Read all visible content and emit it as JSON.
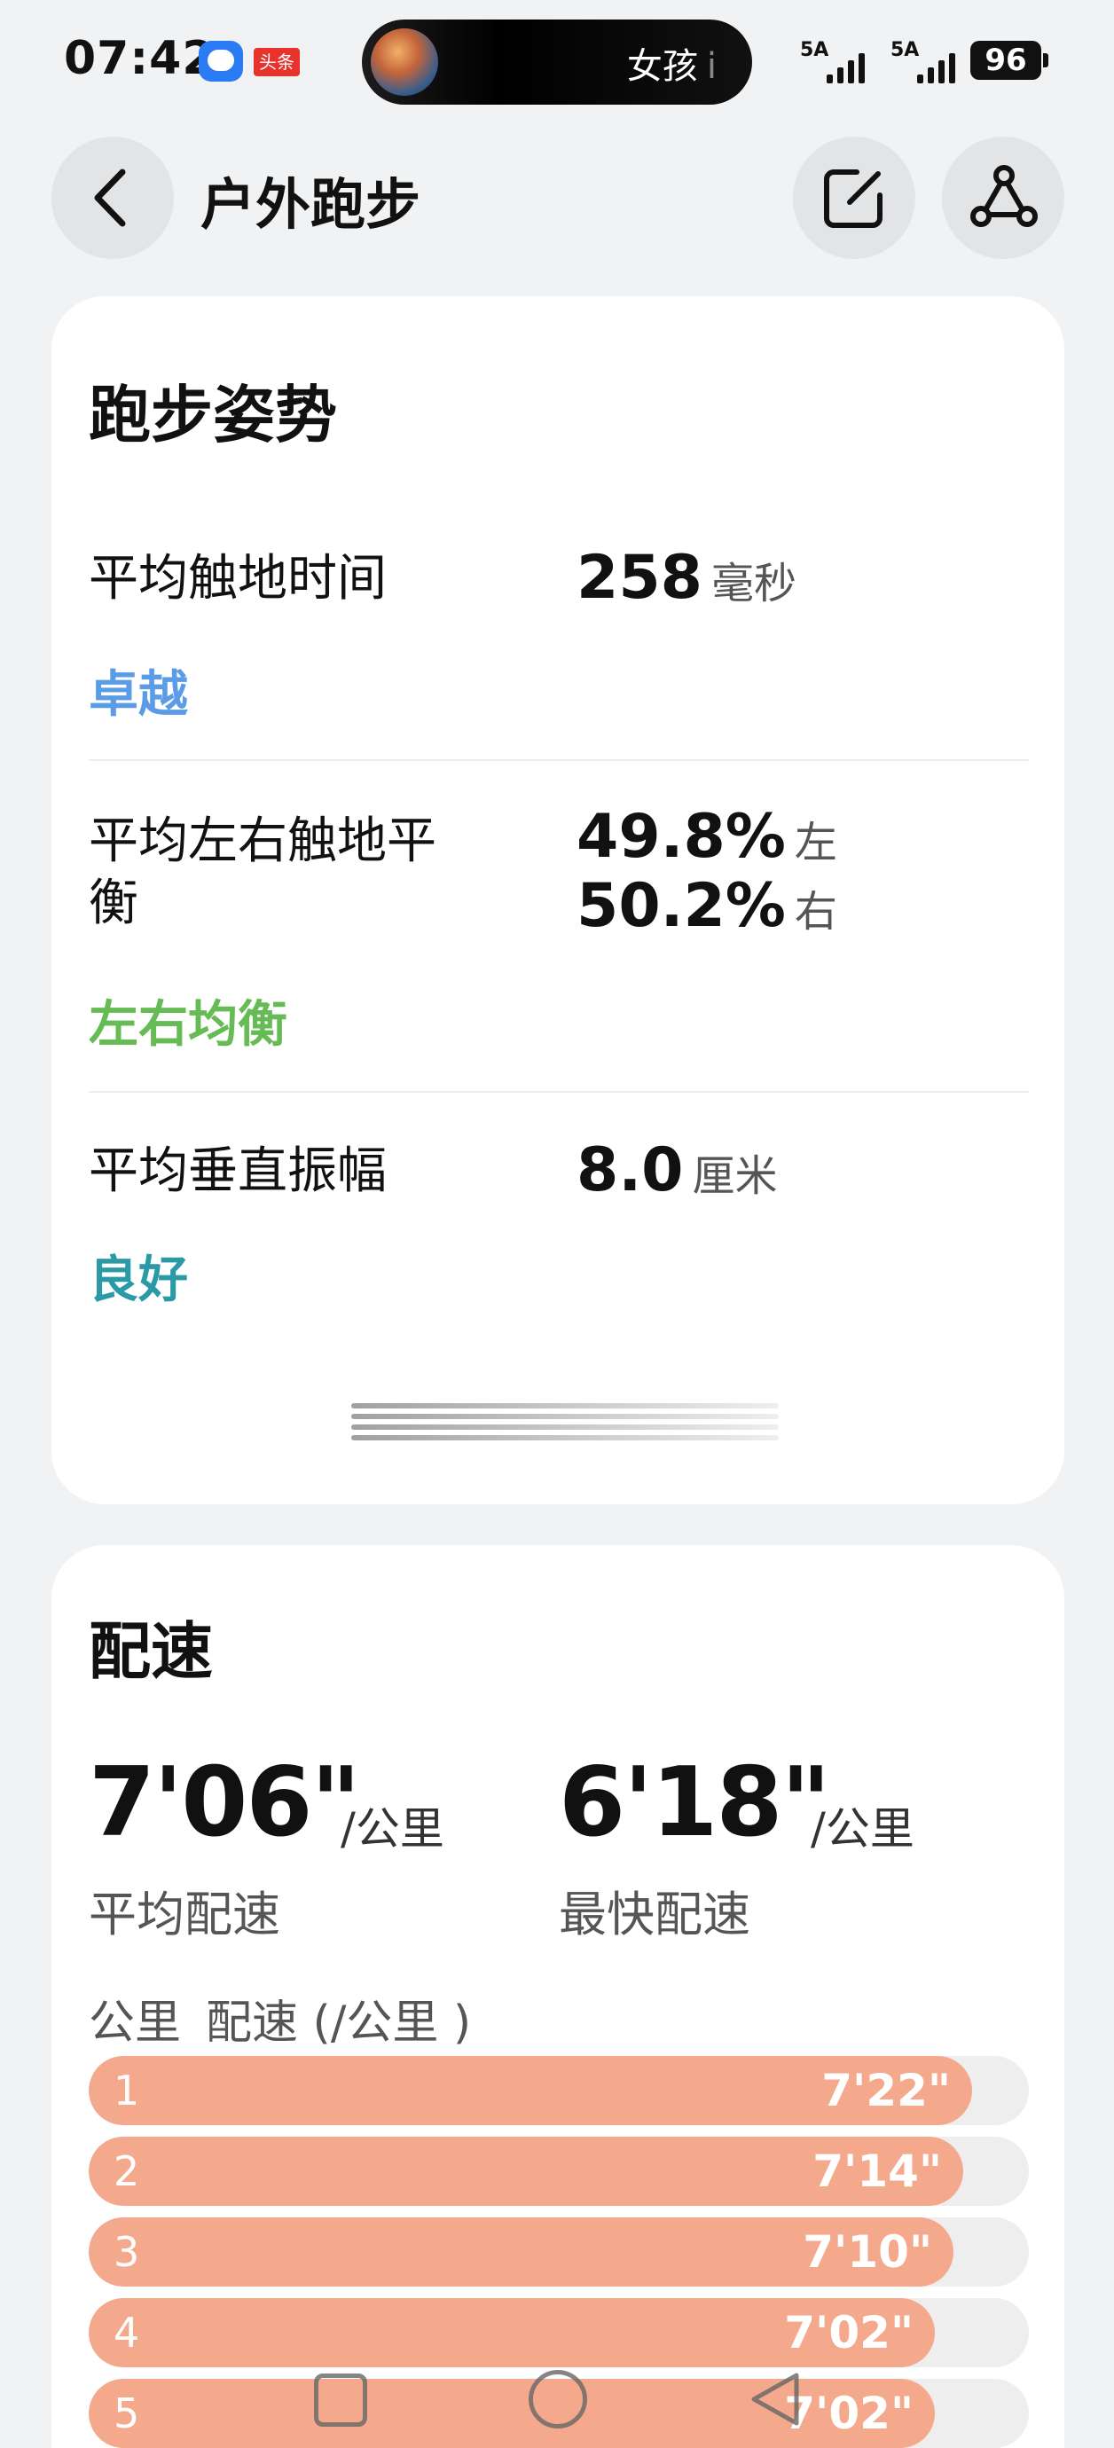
{
  "status_bar": {
    "time": "07:42",
    "toutiao_badge": "头条",
    "media_title": "女孩",
    "media_info_glyph": "i",
    "signal_1": "5A",
    "signal_2": "5A",
    "battery": "96"
  },
  "header": {
    "title": "户外跑步"
  },
  "running_posture": {
    "title": "跑步姿势",
    "contact_time": {
      "label": "平均触地时间",
      "value": "258",
      "unit": "毫秒",
      "rating": "卓越",
      "rating_color": "#5a9de6"
    },
    "balance": {
      "label_line1": "平均左右触地平",
      "label_line2": "衡",
      "left_value": "49.8%",
      "left_unit": "左",
      "right_value": "50.2%",
      "right_unit": "右",
      "rating": "左右均衡",
      "rating_color": "#66bb55"
    },
    "vertical_oscillation": {
      "label": "平均垂直振幅",
      "value": "8.0",
      "unit": "厘米",
      "rating": "良好",
      "rating_color": "#2a9aa6"
    }
  },
  "pace": {
    "title": "配速",
    "average": {
      "value": "7'06\"",
      "unit": "/公里",
      "caption": "平均配速"
    },
    "fastest": {
      "value": "6'18\"",
      "unit": "/公里",
      "caption": "最快配速"
    },
    "split_header_km": "公里",
    "split_header_pace": "配速 (/公里 )",
    "bar_color": "#f4a98c",
    "splits": [
      {
        "km": "1",
        "pace": "7'22\"",
        "fill": 0.94
      },
      {
        "km": "2",
        "pace": "7'14\"",
        "fill": 0.93
      },
      {
        "km": "3",
        "pace": "7'10\"",
        "fill": 0.92
      },
      {
        "km": "4",
        "pace": "7'02\"",
        "fill": 0.9
      },
      {
        "km": "5",
        "pace": "7'02\"",
        "fill": 0.9
      }
    ]
  },
  "nav_bar": {
    "items": [
      "recents-icon",
      "home-icon",
      "back-icon"
    ]
  }
}
